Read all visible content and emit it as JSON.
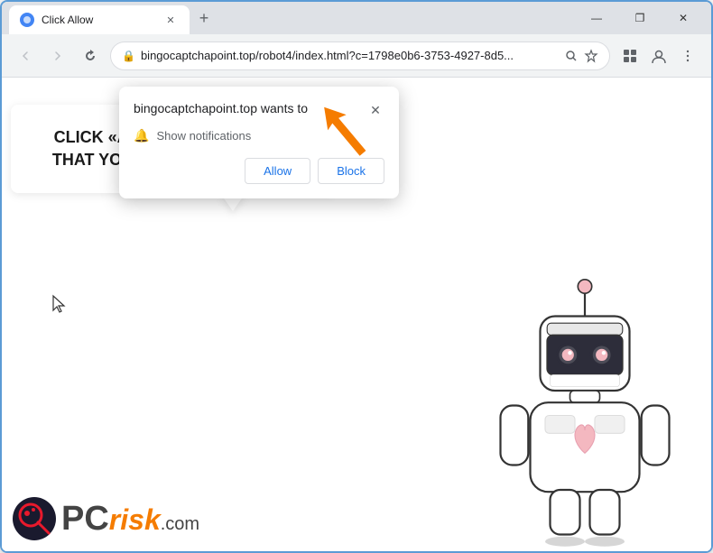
{
  "browser": {
    "tab_title": "Click Allow",
    "tab_favicon_color": "#4285f4",
    "new_tab_label": "+",
    "url": "bingocaptchapoint.top/robot4/index.html?c=1798e0b6-3753-4927-8d5...",
    "url_domain": "bingocaptchapoint.top",
    "nav_back": "‹",
    "nav_forward": "›",
    "nav_refresh": "↺",
    "window_minimize": "—",
    "window_maximize": "❐",
    "window_close": "✕"
  },
  "popup": {
    "site_text": "bingocaptchapoint.top wants to",
    "notification_label": "Show notifications",
    "allow_button": "Allow",
    "block_button": "Block",
    "close_icon": "✕"
  },
  "page": {
    "speech_text": "CLICK «ALLOW» TO CONFIRM THAT YOU ARE NOT A ROBOT!"
  },
  "logo": {
    "pc_text": "PC",
    "risk_text": "risk.com",
    "dot_color": "#e8192c"
  },
  "colors": {
    "accent_blue": "#1a73e8",
    "orange_arrow": "#f57c00",
    "page_bg": "#e8eaed",
    "popup_bg": "#ffffff",
    "browser_chrome": "#dee1e6"
  }
}
